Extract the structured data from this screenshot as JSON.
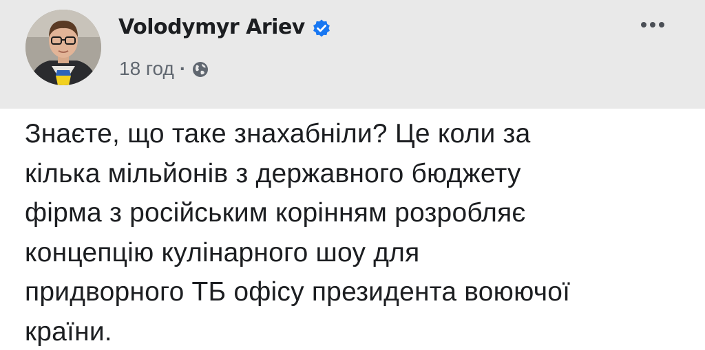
{
  "post": {
    "author": {
      "name": "Volodymyr Ariev",
      "verified": true,
      "avatar_icon": "profile-photo"
    },
    "meta": {
      "time": "18 год",
      "separator": "·",
      "audience_icon": "globe-icon"
    },
    "more_icon": "ellipsis-icon",
    "text_lines": [
      "Знаєте, що таке знахабніли? Це коли за",
      "кілька мільйонів з державного бюджету",
      "фірма з російським корінням розробляє",
      "концепцію кулінарного шоу для",
      "придворного ТБ офісу президента воюючої",
      "країни."
    ]
  },
  "colors": {
    "header_background": "#e9e9e9",
    "verified_badge": "#1877f2",
    "meta_text": "#606770",
    "body_text": "#1c1e21"
  }
}
